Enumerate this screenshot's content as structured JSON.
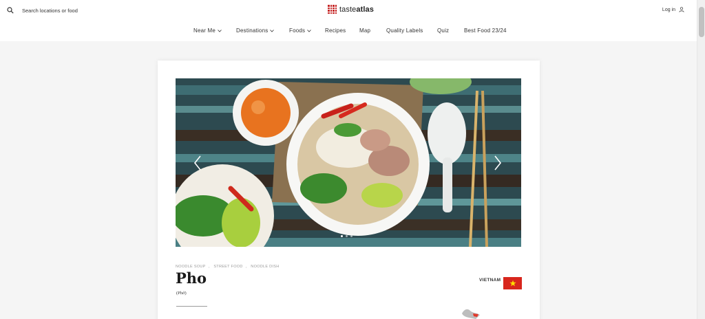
{
  "header": {
    "search_placeholder": "Search locations or food",
    "logo": {
      "brand_plain": "taste",
      "brand_bold": "atlas"
    },
    "login_label": "Log in"
  },
  "nav": {
    "items": [
      {
        "label": "Near Me",
        "has_dropdown": true
      },
      {
        "label": "Destinations",
        "has_dropdown": true
      },
      {
        "label": "Foods",
        "has_dropdown": true
      },
      {
        "label": "Recipes",
        "has_dropdown": false
      },
      {
        "label": "Map",
        "has_dropdown": false
      },
      {
        "label": "Quality Labels",
        "has_dropdown": false
      },
      {
        "label": "Quiz",
        "has_dropdown": false
      },
      {
        "label": "Best Food 23/24",
        "has_dropdown": false
      }
    ]
  },
  "dish": {
    "tags": [
      "NOODLE SOUP",
      "STREET FOOD",
      "NOODLE DISH"
    ],
    "name": "Pho",
    "local_name": "(Phở)",
    "country": "VIETNAM",
    "photo_alt": "bowl of pho with herbs, chili, lime and chopsticks"
  },
  "carousel": {
    "slide_count": 3,
    "active_slide": 1
  },
  "colors": {
    "accent": "#c62828",
    "flag_red": "#d8261d",
    "flag_star": "#ffde00"
  },
  "icons": [
    "search-icon",
    "user-icon",
    "chevron-down-icon",
    "arrow-left-icon",
    "arrow-right-icon",
    "star-icon"
  ]
}
